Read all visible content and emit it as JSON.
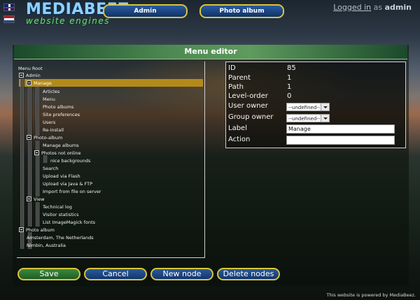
{
  "header": {
    "logo_title": "MEDIABEEZ",
    "logo_subtitle": "website engines",
    "nav": [
      {
        "label": "Admin"
      },
      {
        "label": "Photo album"
      }
    ],
    "login": {
      "link": "Logged in",
      "as": "as",
      "user": "admin"
    }
  },
  "editor": {
    "title": "Menu editor",
    "tree": [
      {
        "label": "Menu Root",
        "depth": 0,
        "box": false
      },
      {
        "label": "Admin",
        "depth": 0,
        "box": true
      },
      {
        "label": "Manage",
        "depth": 1,
        "box": true,
        "selected": true
      },
      {
        "label": "Articles",
        "depth": 2,
        "box": false
      },
      {
        "label": "Menu",
        "depth": 2,
        "box": false
      },
      {
        "label": "Photo albums",
        "depth": 2,
        "box": false
      },
      {
        "label": "Site preferences",
        "depth": 2,
        "box": false
      },
      {
        "label": "Users",
        "depth": 2,
        "box": false
      },
      {
        "label": "Re-install",
        "depth": 2,
        "box": false
      },
      {
        "label": "Photo-album",
        "depth": 1,
        "box": true
      },
      {
        "label": "Manage albums",
        "depth": 2,
        "box": false
      },
      {
        "label": "Photos not online",
        "depth": 2,
        "box": true
      },
      {
        "label": "nice backgrounds",
        "depth": 3,
        "box": false
      },
      {
        "label": "Search",
        "depth": 2,
        "box": false
      },
      {
        "label": "Upload via Flash",
        "depth": 2,
        "box": false
      },
      {
        "label": "Upload via Java & FTP",
        "depth": 2,
        "box": false
      },
      {
        "label": "Import from file on server",
        "depth": 2,
        "box": false
      },
      {
        "label": "View",
        "depth": 1,
        "box": true
      },
      {
        "label": "Technical log",
        "depth": 2,
        "box": false
      },
      {
        "label": "Visitor statistics",
        "depth": 2,
        "box": false
      },
      {
        "label": "List ImageMagick fonts",
        "depth": 2,
        "box": false
      },
      {
        "label": "Photo album",
        "depth": 0,
        "box": true
      },
      {
        "label": "Amsterdam, The Netherlands",
        "depth": 1,
        "box": false
      },
      {
        "label": "Nimbin, Australia",
        "depth": 1,
        "box": false
      }
    ],
    "props": {
      "id_label": "ID",
      "id": "85",
      "parent_label": "Parent",
      "parent": "1",
      "path_label": "Path",
      "path": "1",
      "order_label": "Level-order",
      "order": "0",
      "user_owner_label": "User owner",
      "user_owner": "--undefined--",
      "group_owner_label": "Group owner",
      "group_owner": "--undefined--",
      "label_label": "Label",
      "label": "Manage",
      "action_label": "Action",
      "action": ""
    },
    "buttons": {
      "save": "Save",
      "cancel": "Cancel",
      "new_node": "New node",
      "delete_nodes": "Delete nodes"
    }
  },
  "footer": {
    "text": "This website is powered by MediaBeez."
  },
  "colors": {
    "accent": "#d8c43c",
    "selected": "#b38a1a",
    "title_bar": "#4d8a52"
  }
}
